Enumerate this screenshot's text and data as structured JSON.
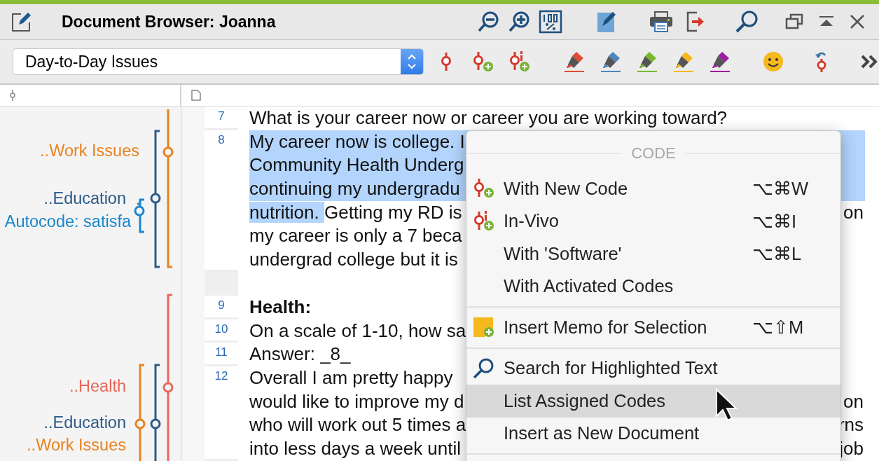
{
  "window": {
    "title": "Document Browser: Joanna"
  },
  "toolbar": {
    "document_set": "Day-to-Day Issues"
  },
  "margin": {
    "codes": [
      {
        "label": "..Work Issues",
        "color": "#e8821e"
      },
      {
        "label": "..Education",
        "color": "#2b5a86"
      },
      {
        "label": "Autocode: satisfa",
        "color": "#1a86cc"
      },
      {
        "label": "..Health",
        "color": "#e8685a"
      },
      {
        "label": "..Education",
        "color": "#2b5a86"
      },
      {
        "label": "..Work Issues",
        "color": "#e8821e"
      }
    ]
  },
  "document": {
    "paragraphs": [
      {
        "kind": "text",
        "number": "7",
        "lines": [
          {
            "highlighted": false,
            "text": "What is your career now or career you are working toward?"
          }
        ]
      },
      {
        "kind": "text",
        "number": "8",
        "lines": [
          {
            "highlighted": true,
            "text": "My career now is college. I"
          },
          {
            "highlighted": true,
            "text": "Community Health Underg"
          },
          {
            "highlighted": true,
            "text": "continuing my undergradu"
          },
          {
            "highlighted": false,
            "segments": [
              {
                "text": "nutrition. ",
                "highlighted": true
              },
              {
                "text": " Getting my RD is",
                "highlighted": false
              }
            ],
            "right_fragment": "on"
          },
          {
            "highlighted": false,
            "text": "my career is only a 7 beca"
          },
          {
            "highlighted": false,
            "text": "undergrad college but it is"
          }
        ]
      },
      {
        "kind": "empty"
      },
      {
        "kind": "heading",
        "number": "9",
        "lines": [
          {
            "highlighted": false,
            "text": "Health:"
          }
        ]
      },
      {
        "kind": "text",
        "number": "10",
        "lines": [
          {
            "highlighted": false,
            "text": "On a scale of 1-10, how sa"
          }
        ]
      },
      {
        "kind": "text",
        "number": "11",
        "lines": [
          {
            "highlighted": false,
            "text": "Answer: _8_"
          }
        ]
      },
      {
        "kind": "text",
        "number": "12",
        "lines": [
          {
            "highlighted": false,
            "text": "Overall I am pretty happy"
          },
          {
            "highlighted": false,
            "text": "would like to improve my d",
            "right_fragment": "on"
          },
          {
            "highlighted": false,
            "text": "who will work out 5 times a",
            "right_fragment": "rns"
          },
          {
            "highlighted": false,
            "text": "into less days a week until",
            "right_fragment": "job"
          }
        ]
      }
    ]
  },
  "context_menu": {
    "header": "CODE",
    "groups": [
      {
        "items": [
          {
            "label": "With New Code",
            "shortcut": "⌥⌘W",
            "selected": false
          },
          {
            "label": "In-Vivo",
            "shortcut": "⌥⌘I",
            "selected": false
          },
          {
            "label": "With 'Software'",
            "shortcut": "⌥⌘L",
            "selected": false
          },
          {
            "label": "With Activated Codes",
            "selected": false
          }
        ]
      },
      {
        "items": [
          {
            "label": "Insert Memo for Selection",
            "shortcut": "⌥⇧M",
            "selected": false
          }
        ]
      },
      {
        "items": [
          {
            "label": "Search for Highlighted Text",
            "selected": false
          },
          {
            "label": "List Assigned Codes",
            "selected": true
          },
          {
            "label": "Insert as New Document",
            "selected": false
          }
        ]
      }
    ]
  }
}
